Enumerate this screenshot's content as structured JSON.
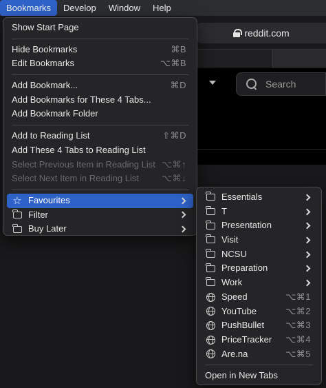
{
  "menubar": {
    "items": [
      {
        "label": "Bookmarks",
        "active": true
      },
      {
        "label": "Develop"
      },
      {
        "label": "Window"
      },
      {
        "label": "Help"
      }
    ]
  },
  "browser": {
    "address": "reddit.com",
    "search_placeholder": "Search"
  },
  "bookmarks_menu": {
    "show_start_page": "Show Start Page",
    "hide_bookmarks": {
      "label": "Hide Bookmarks",
      "shortcut": "⌘B"
    },
    "edit_bookmarks": {
      "label": "Edit Bookmarks",
      "shortcut": "⌥⌘B"
    },
    "add_bookmark": {
      "label": "Add Bookmark...",
      "shortcut": "⌘D"
    },
    "add_bookmarks_tabs": {
      "label": "Add Bookmarks for These 4 Tabs..."
    },
    "add_bookmark_folder": {
      "label": "Add Bookmark Folder"
    },
    "add_reading_list": {
      "label": "Add to Reading List",
      "shortcut": "⇧⌘D"
    },
    "add_tabs_reading_list": {
      "label": "Add These 4 Tabs to Reading List"
    },
    "select_previous": {
      "label": "Select Previous Item in Reading List",
      "shortcut": "⌥⌘↑"
    },
    "select_next": {
      "label": "Select Next Item in Reading List",
      "shortcut": "⌥⌘↓"
    },
    "favourites": {
      "label": "Favourites"
    },
    "filter": {
      "label": "Filter"
    },
    "buy_later": {
      "label": "Buy Later"
    }
  },
  "favourites_menu": {
    "folders": [
      {
        "label": "Essentials",
        "icon": "folder-icon"
      },
      {
        "label": "T",
        "icon": "folder-icon"
      },
      {
        "label": "Presentation",
        "icon": "folder-icon"
      },
      {
        "label": "Visit",
        "icon": "folder-icon"
      },
      {
        "label": "NCSU",
        "icon": "folder-icon"
      },
      {
        "label": "Preparation",
        "icon": "folder-icon"
      },
      {
        "label": "Work",
        "icon": "folder-icon"
      }
    ],
    "sites": [
      {
        "label": "Speed",
        "shortcut": "⌥⌘1",
        "icon": "globe-icon"
      },
      {
        "label": "YouTube",
        "shortcut": "⌥⌘2",
        "icon": "globe-icon"
      },
      {
        "label": "PushBullet",
        "shortcut": "⌥⌘3",
        "icon": "globe-icon"
      },
      {
        "label": "PriceTracker",
        "shortcut": "⌥⌘4",
        "icon": "globe-icon"
      },
      {
        "label": "Are.na",
        "shortcut": "⌥⌘5",
        "icon": "globe-icon"
      }
    ],
    "open_in_new_tabs": "Open in New Tabs"
  },
  "colors": {
    "highlight": "#2f62c8",
    "menu_bg": "#262628",
    "disabled_text": "#6a6a6e"
  }
}
